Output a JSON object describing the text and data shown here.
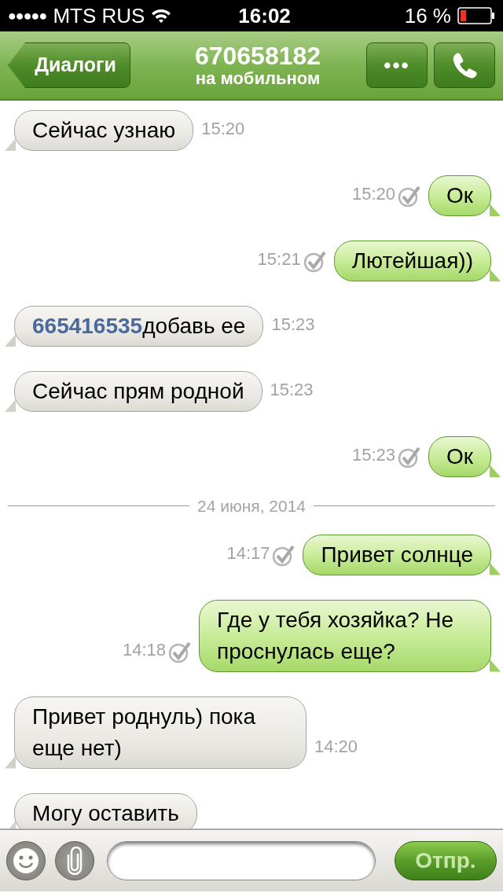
{
  "status_bar": {
    "signal_dots": "●●●●●",
    "carrier": "MTS RUS",
    "time": "16:02",
    "battery": "16 %"
  },
  "header": {
    "back": "Диалоги",
    "title": "670658182",
    "subtitle": "на мобильном",
    "more": "•••"
  },
  "messages": [
    {
      "kind": "in",
      "text": "Сейчас узнаю",
      "time": "15:20"
    },
    {
      "kind": "out",
      "text": "Ок",
      "time": "15:20",
      "delivered": true
    },
    {
      "kind": "out",
      "text": "Лютейшая))",
      "time": "15:21",
      "delivered": true
    },
    {
      "kind": "in",
      "link": "665416535",
      "text": "добавь ее",
      "time": "15:23"
    },
    {
      "kind": "in",
      "text": "Сейчас прям родной",
      "time": "15:23"
    },
    {
      "kind": "out",
      "text": "Ок",
      "time": "15:23",
      "delivered": true
    },
    {
      "kind": "date",
      "text": "24 июня, 2014"
    },
    {
      "kind": "out",
      "text": "Привет солнце",
      "time": "14:17",
      "delivered": true
    },
    {
      "kind": "out",
      "text": "Где у тебя хозяйка? Не проснулась еще?",
      "time": "14:18",
      "delivered": true
    },
    {
      "kind": "in",
      "text": "Привет роднуль) пока еще нет)",
      "time": "14:20"
    },
    {
      "kind": "in",
      "text": "Могу оставить"
    }
  ],
  "composer": {
    "send": "Отпр."
  }
}
